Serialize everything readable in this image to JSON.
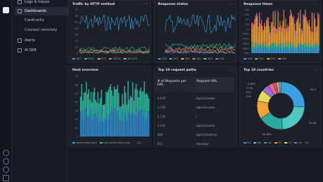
{
  "sidebar": {
    "items": [
      {
        "label": "Logs & traces",
        "chevron": "‹"
      },
      {
        "label": "Dashboards",
        "chevron": "⌄"
      },
      {
        "label": "Cardinality"
      },
      {
        "label": "Connect remotely"
      },
      {
        "label": "Alerts",
        "chevron": "‹"
      },
      {
        "label": "AI SRE"
      }
    ]
  },
  "panels": {
    "traffic": {
      "title": "Traffic by HTTP method",
      "legend": [
        "GET",
        "POST",
        "PUT",
        "PATCH",
        "DELETE"
      ],
      "yticks": [
        "70",
        "60",
        "50",
        "40",
        "30",
        "20",
        "10",
        "0"
      ]
    },
    "status": {
      "title": "Response status",
      "legend": [
        "200",
        "301",
        "302",
        "401",
        "403",
        "404"
      ]
    },
    "times": {
      "title": "Response times",
      "legend": [
        "P50",
        "P90",
        "P95",
        "P99"
      ],
      "yticks": [
        "1.8s",
        "1.6s",
        "1.4s",
        "1.2s",
        "1s",
        "800ms",
        "600ms",
        "400ms",
        "200ms",
        "0ms"
      ]
    },
    "host": {
      "title": "Host overview",
      "legend": [
        "betterstack.com",
        "logs.betterstack.com"
      ],
      "pager": "1/2",
      "yticks": [
        "70",
        "60",
        "50",
        "40",
        "30",
        "20",
        "10",
        "0"
      ]
    },
    "paths": {
      "title": "Top 10 request paths",
      "col1": "# of Requests per URL",
      "col2": "Request URL",
      "rows": [
        {
          "count": "4,478",
          "url": "/api/v1/nodes"
        },
        {
          "count": "2,749",
          "url": "/api/v1/nodes"
        },
        {
          "count": "2,726",
          "url": "/"
        },
        {
          "count": "1,244",
          "url": "/api/v1/nodes"
        },
        {
          "count": "888",
          "url": "/api/v1/metrics"
        },
        {
          "count": "873",
          "url": "/docs/api"
        }
      ]
    },
    "countries": {
      "title": "Top 10 countries",
      "legend": [
        "US",
        "DE",
        "GB",
        "FR",
        "CZ",
        "CA"
      ],
      "pager": "1/2",
      "slices": [
        {
          "label": "US",
          "value": 24.5,
          "color": "#3aa0e0"
        },
        {
          "label": "DE",
          "value": 21.84,
          "color": "#4fc7c0"
        },
        {
          "label": "GB",
          "value": 16.16,
          "color": "#2fa6a0"
        },
        {
          "label": "FR",
          "value": 11.6,
          "color": "#f2a33a"
        },
        {
          "label": "CZ",
          "value": 7.4,
          "color": "#e8d85a"
        },
        {
          "label": "CA",
          "value": 4.9,
          "color": "#9b6fd6"
        },
        {
          "label": "",
          "value": 3.28,
          "color": "#e96a8a"
        },
        {
          "label": "",
          "value": 2.1,
          "color": "#d95a5a"
        },
        {
          "label": "",
          "value": 1.72,
          "color": "#ff8fb0"
        },
        {
          "label": "",
          "value": 1.17,
          "color": "#6bd07a"
        }
      ],
      "labels": [
        "24.5%",
        "21.84%",
        "16.16%",
        "3.28%",
        "2.1%",
        "1.72%",
        "1.17%"
      ]
    }
  },
  "colors": {
    "blue": "#3aa0e0",
    "teal": "#30c0a8",
    "orange": "#f2a33a",
    "pink": "#e96a8a",
    "green": "#6bd07a",
    "purple": "#9b6fd6"
  }
}
